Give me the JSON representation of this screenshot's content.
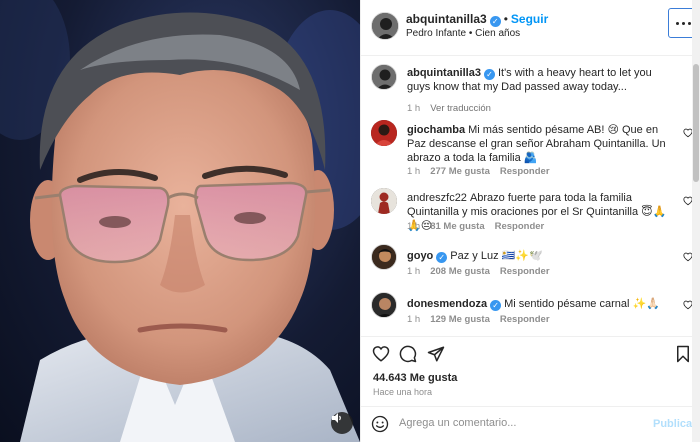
{
  "photo": {
    "alt_subject": ""
  },
  "header": {
    "username": "abquintanilla3",
    "follow_label": "Seguir",
    "separator": "•",
    "audio": "Pedro Infante • Cien años"
  },
  "caption": {
    "username": "abquintanilla3",
    "text": "It's with a heavy heart to let you guys know that my Dad passed away today...",
    "time": "1 h",
    "translate": "Ver traducción"
  },
  "comments": [
    {
      "username": "giochamba",
      "text": "Mi más sentido pésame AB! 😢 Que en Paz descanse el gran señor Abraham Quintanilla. Un abrazo a toda la familia 🫂",
      "time": "1 h",
      "likes": "277 Me gusta",
      "reply": "Responder"
    },
    {
      "username": "andreszfc22",
      "text": "Abrazo fuerte para toda la familia Quintanilla y mis oraciones por el Sr Quintanilla 😇🙏🙏😔",
      "time": "1 h",
      "likes": "81 Me gusta",
      "reply": "Responder"
    },
    {
      "username": "goyo",
      "text": "Paz y Luz 🇺🇾✨🕊️",
      "time": "1 h",
      "likes": "208 Me gusta",
      "reply": "Responder"
    },
    {
      "username": "donesmendoza",
      "text": "Mi sentido pésame carnal ✨🙏🏻",
      "time": "1 h",
      "likes": "129 Me gusta",
      "reply": "Responder"
    }
  ],
  "actions": {
    "likes": "44.643 Me gusta",
    "time": "Hace una hora"
  },
  "add_comment": {
    "placeholder": "Agrega un comentario...",
    "publish": "Publicar"
  },
  "colors": {
    "accent": "#0095f6",
    "verified": "#3897f0",
    "muted_text": "#8e8e8e",
    "publish_disabled": "#b2dffc"
  }
}
